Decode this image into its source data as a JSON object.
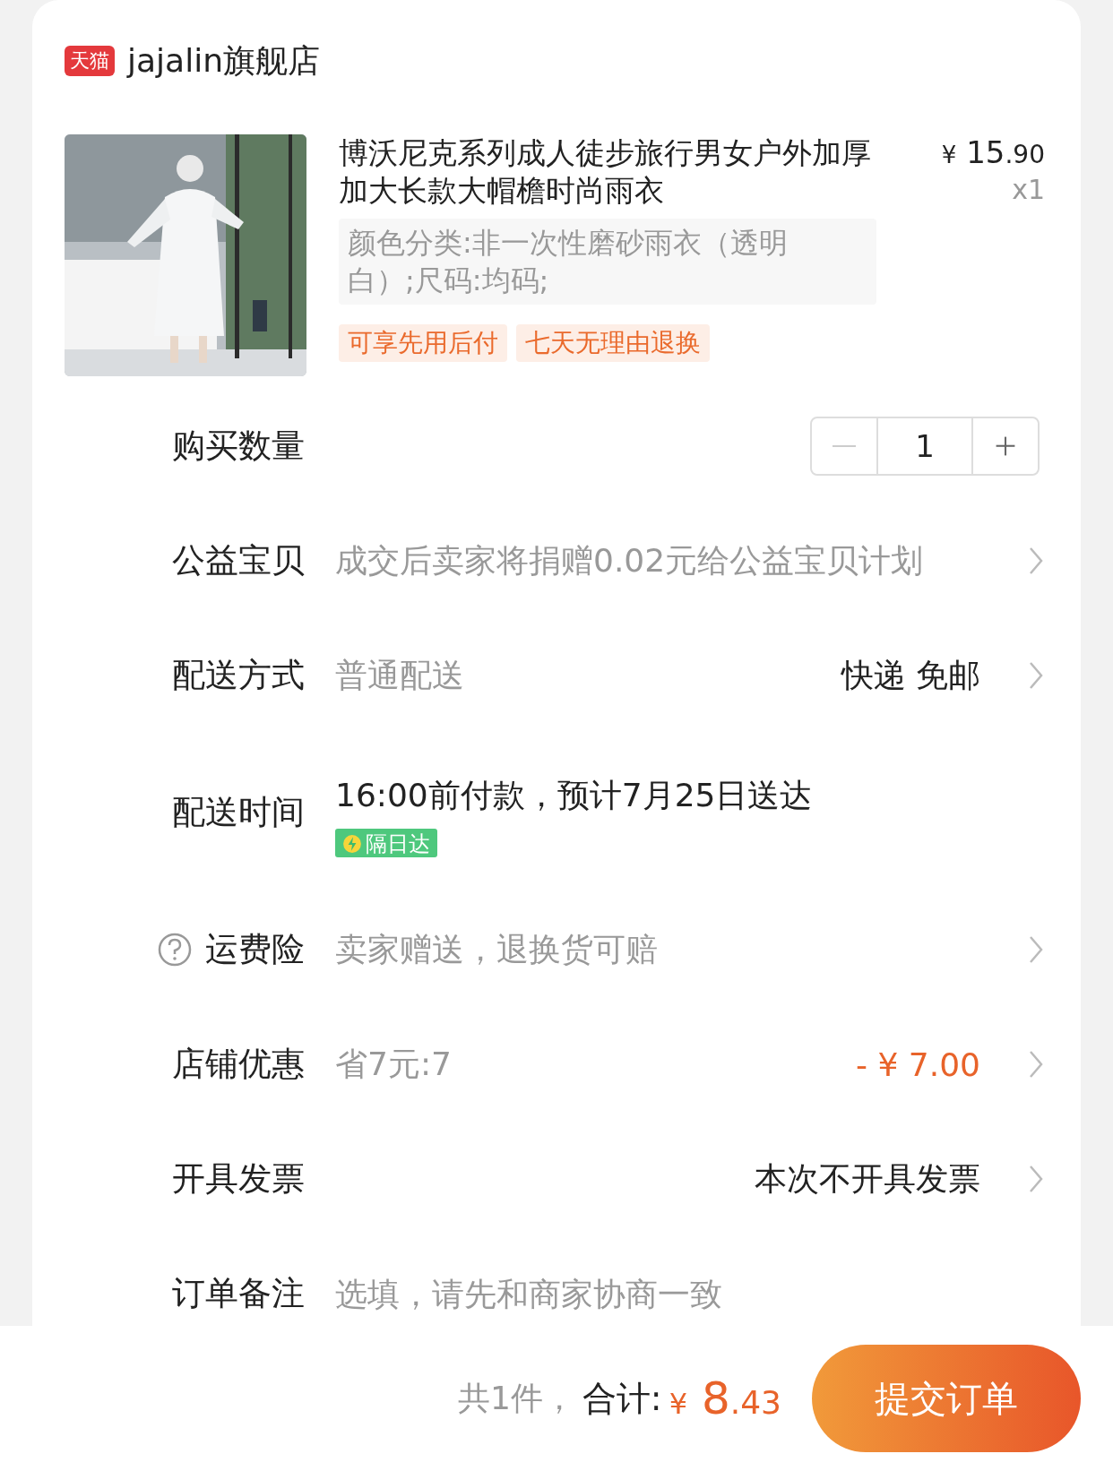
{
  "store": {
    "badge": "天猫",
    "name": "jajalin旗舰店"
  },
  "product": {
    "kind": "picture",
    "title": "博沃尼克系列成人徒步旅行男女户外加厚加大长款大帽檐时尚雨衣",
    "price": {
      "symbol": "¥",
      "integer": "15",
      "decimal": ".90"
    },
    "quantity": "x1",
    "sku": "颜色分类:非一次性磨砂雨衣（透明白）;尺码:均码;",
    "tags": [
      "可享先用后付",
      "七天无理由退换"
    ]
  },
  "rows": [
    {
      "kind": "stepper",
      "label": "购买数量",
      "value": "1",
      "minus_disabled": true
    },
    {
      "kind": "link",
      "label": "公益宝贝",
      "value": "成交后卖家将捐赠0.02元给公益宝贝计划"
    },
    {
      "kind": "option",
      "label": "配送方式",
      "value": "普通配送",
      "detail": "快递 免邮"
    },
    {
      "kind": "schedule",
      "label": "配送时间",
      "value": "16:00前付款，预计7月25日送达",
      "badge": "隔日达"
    },
    {
      "kind": "help_link",
      "label": "运费险",
      "value": "卖家赠送，退换货可赔"
    },
    {
      "kind": "discount",
      "label": "店铺优惠",
      "value": "省7元:7",
      "detail": "- ¥ 7.00"
    },
    {
      "kind": "option",
      "label": "开具发票",
      "detail": "本次不开具发票"
    },
    {
      "kind": "note",
      "label": "订单备注",
      "placeholder": "选填，请先和商家协商一致"
    }
  ],
  "footer": {
    "count": "共1件，",
    "total_label": "合计:",
    "symbol": "¥",
    "integer": "8",
    "decimal": ".43",
    "button": "提交订单"
  }
}
